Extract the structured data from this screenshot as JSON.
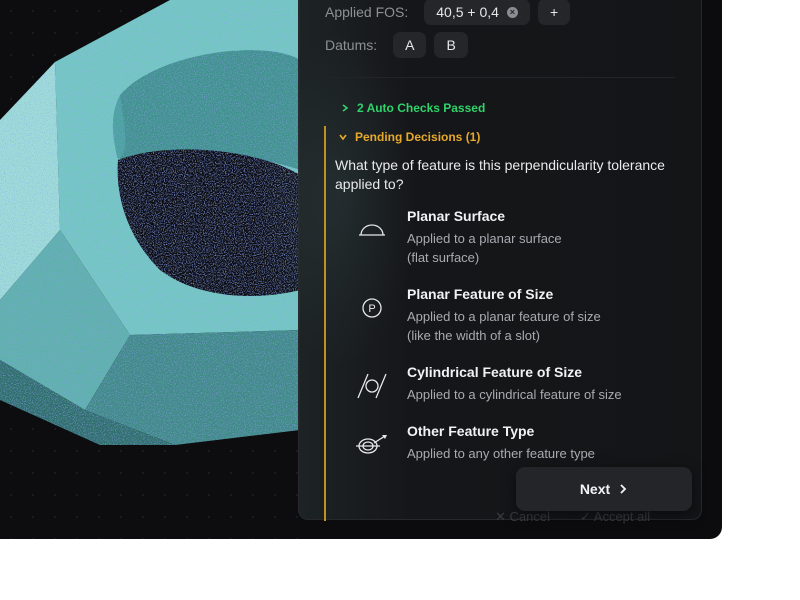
{
  "header": {
    "fos_label": "Applied FOS:",
    "fos_value": "40,5 + 0,4",
    "add_label": "+",
    "datums_label": "Datums:",
    "datums": [
      "A",
      "B"
    ]
  },
  "checks": {
    "passed_label": "2 Auto Checks Passed"
  },
  "pending": {
    "label": "Pending Decisions (1)",
    "question": "What type of feature is this perpendicularity tolerance applied to?",
    "options": [
      {
        "title": "Planar Surface",
        "desc": [
          "Applied to a planar surface",
          "(flat surface)"
        ],
        "icon": "planar-surface-icon"
      },
      {
        "title": "Planar Feature of Size",
        "desc": [
          "Applied to a planar feature of size",
          "(like the width of a slot)"
        ],
        "icon": "planar-feature-of-size-icon"
      },
      {
        "title": "Cylindrical Feature of Size",
        "desc": [
          "Applied to a cylindrical feature of size"
        ],
        "icon": "cylindrical-feature-icon"
      },
      {
        "title": "Other Feature Type",
        "desc": [
          "Applied to any other feature type"
        ],
        "icon": "other-feature-icon"
      }
    ]
  },
  "footer": {
    "cancel_label": "Cancel",
    "accept_label": "Accept all"
  },
  "actions": {
    "next_label": "Next"
  },
  "colors": {
    "accent_green": "#2fd36a",
    "accent_amber": "#e6a92c",
    "panel": "#151619",
    "model_teal": "#6fc6c0"
  }
}
